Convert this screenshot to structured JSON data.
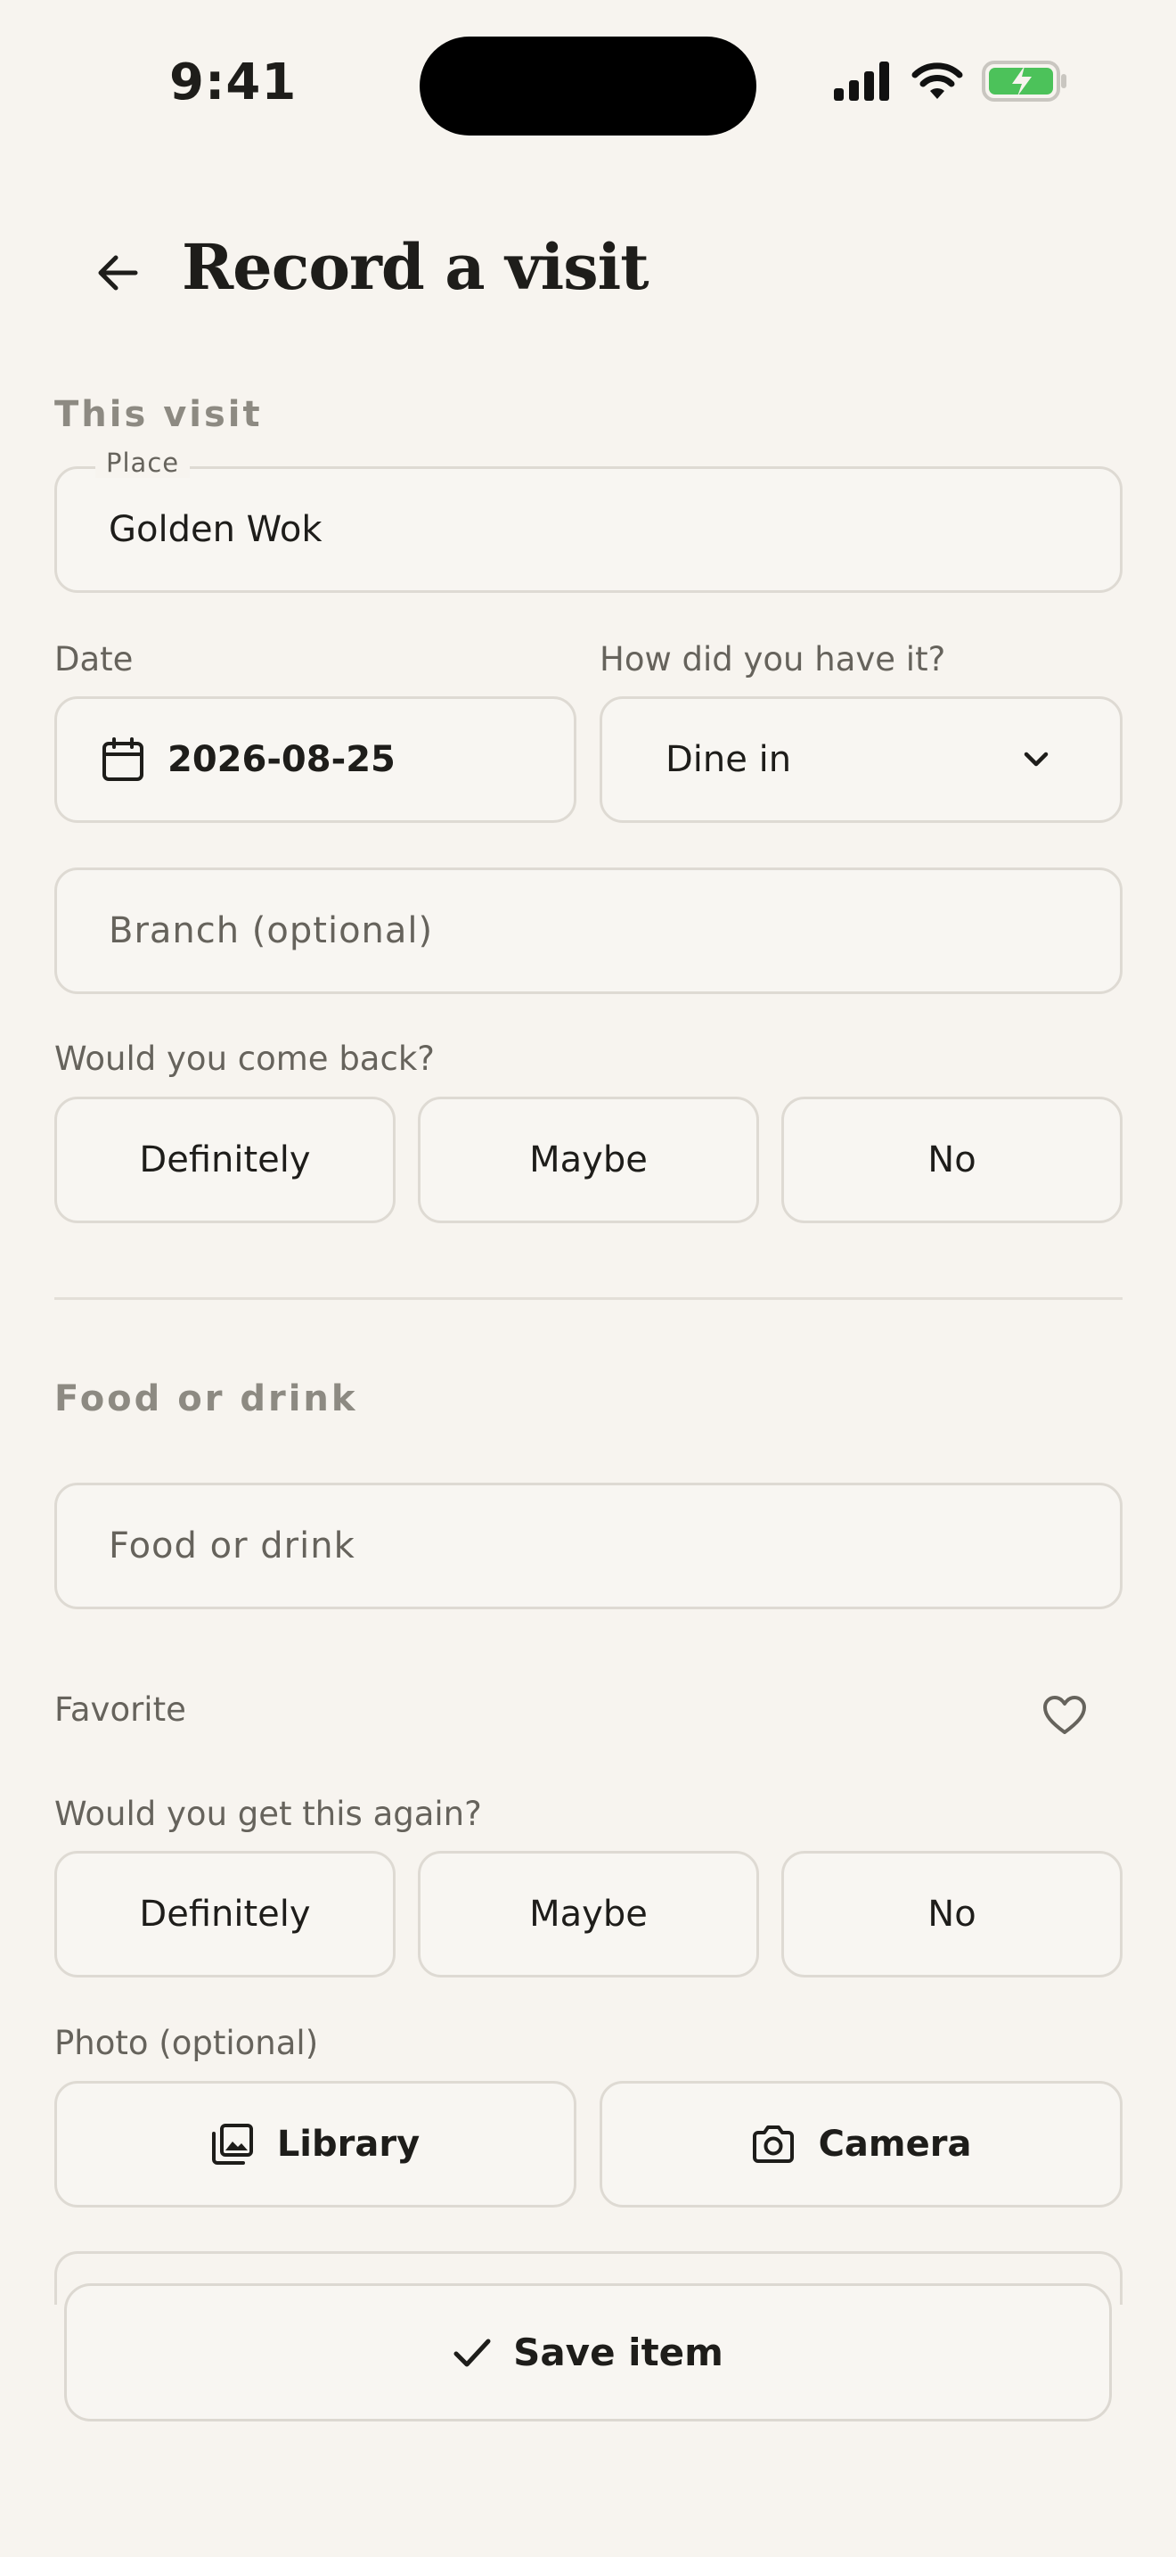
{
  "status_bar": {
    "time": "9:41"
  },
  "header": {
    "title": "Record a visit"
  },
  "visit": {
    "section_label": "This visit",
    "place_label": "Place",
    "place_value": "Golden Wok",
    "date_label": "Date",
    "date_value": "2026-08-25",
    "how_label": "How did you have it?",
    "how_value": "Dine in",
    "branch_placeholder": "Branch (optional)",
    "come_back_label": "Would you come back?",
    "come_back_options": [
      "Definitely",
      "Maybe",
      "No"
    ]
  },
  "food": {
    "section_label": "Food or drink",
    "name_placeholder": "Food or drink",
    "favorite_label": "Favorite",
    "again_label": "Would you get this again?",
    "again_options": [
      "Definitely",
      "Maybe",
      "No"
    ],
    "photo_label": "Photo (optional)",
    "library_label": "Library",
    "camera_label": "Camera"
  },
  "footer": {
    "save_label": "Save item"
  },
  "colors": {
    "background": "#f7f4ef",
    "border": "#dedad3",
    "battery": "#4cc25a"
  }
}
